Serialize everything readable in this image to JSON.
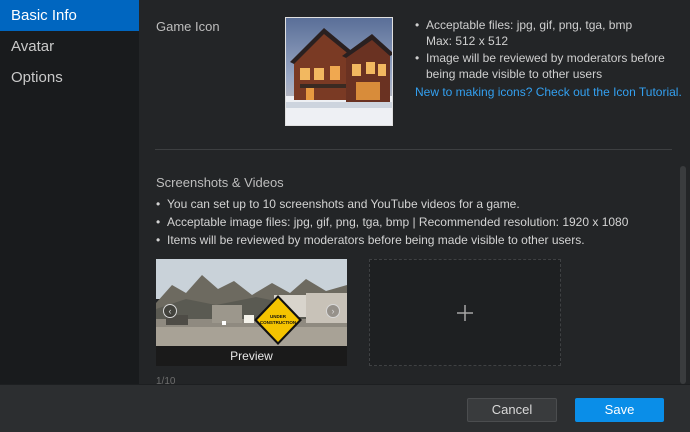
{
  "sidebar": {
    "items": [
      {
        "label": "Basic Info",
        "active": true
      },
      {
        "label": "Avatar",
        "active": false
      },
      {
        "label": "Options",
        "active": false
      }
    ]
  },
  "game_icon": {
    "label": "Game Icon",
    "rules": [
      {
        "text": "Acceptable files: jpg, gif, png, tga, bmp",
        "sub": "Max: 512 x 512"
      },
      {
        "text": "Image will be reviewed by moderators before being made visible to other users"
      }
    ],
    "tutorial_link": "New to making icons? Check out the Icon Tutorial."
  },
  "screenshots": {
    "title": "Screenshots & Videos",
    "rules": [
      "You can set up to 10 screenshots and YouTube videos for a game.",
      "Acceptable image files: jpg, gif, png, tga, bmp | Recommended resolution: 1920 x 1080",
      "Items will be reviewed by moderators before being made visible to other users."
    ],
    "preview_caption": "Preview",
    "sign_text_line1": "UNDER",
    "sign_text_line2": "CONSTRUCTION",
    "counter": "1/10"
  },
  "footer": {
    "cancel_label": "Cancel",
    "save_label": "Save"
  },
  "colors": {
    "accent": "#0066c0",
    "save_button": "#0a8ee8",
    "link": "#33a0f0",
    "background": "#232527",
    "sidebar_background": "#191b1d"
  }
}
